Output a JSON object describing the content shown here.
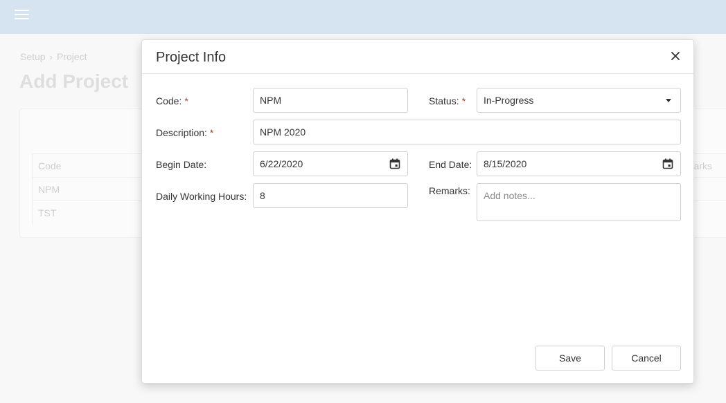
{
  "background": {
    "breadcrumb": {
      "root": "Setup",
      "separator": "›",
      "current": "Project"
    },
    "page_title": "Add Project",
    "table": {
      "header": "Code",
      "rows": [
        "NPM",
        "TST"
      ],
      "remarks_header_fragment": "arks"
    }
  },
  "modal": {
    "title": "Project Info",
    "fields": {
      "code": {
        "label": "Code:",
        "required": "*",
        "value": "NPM"
      },
      "status": {
        "label": "Status:",
        "required": "*",
        "value": "In-Progress"
      },
      "description": {
        "label": "Description:",
        "required": "*",
        "value": "NPM 2020"
      },
      "begin_date": {
        "label": "Begin Date:",
        "value": "6/22/2020"
      },
      "end_date": {
        "label": "End Date:",
        "value": "8/15/2020"
      },
      "daily_hours": {
        "label": "Daily Working Hours:",
        "value": "8"
      },
      "remarks": {
        "label": "Remarks:",
        "placeholder": "Add notes..."
      }
    },
    "buttons": {
      "save": "Save",
      "cancel": "Cancel"
    }
  },
  "colors": {
    "topbar": "#d6e3f1",
    "required_asterisk": "#d0342c"
  }
}
